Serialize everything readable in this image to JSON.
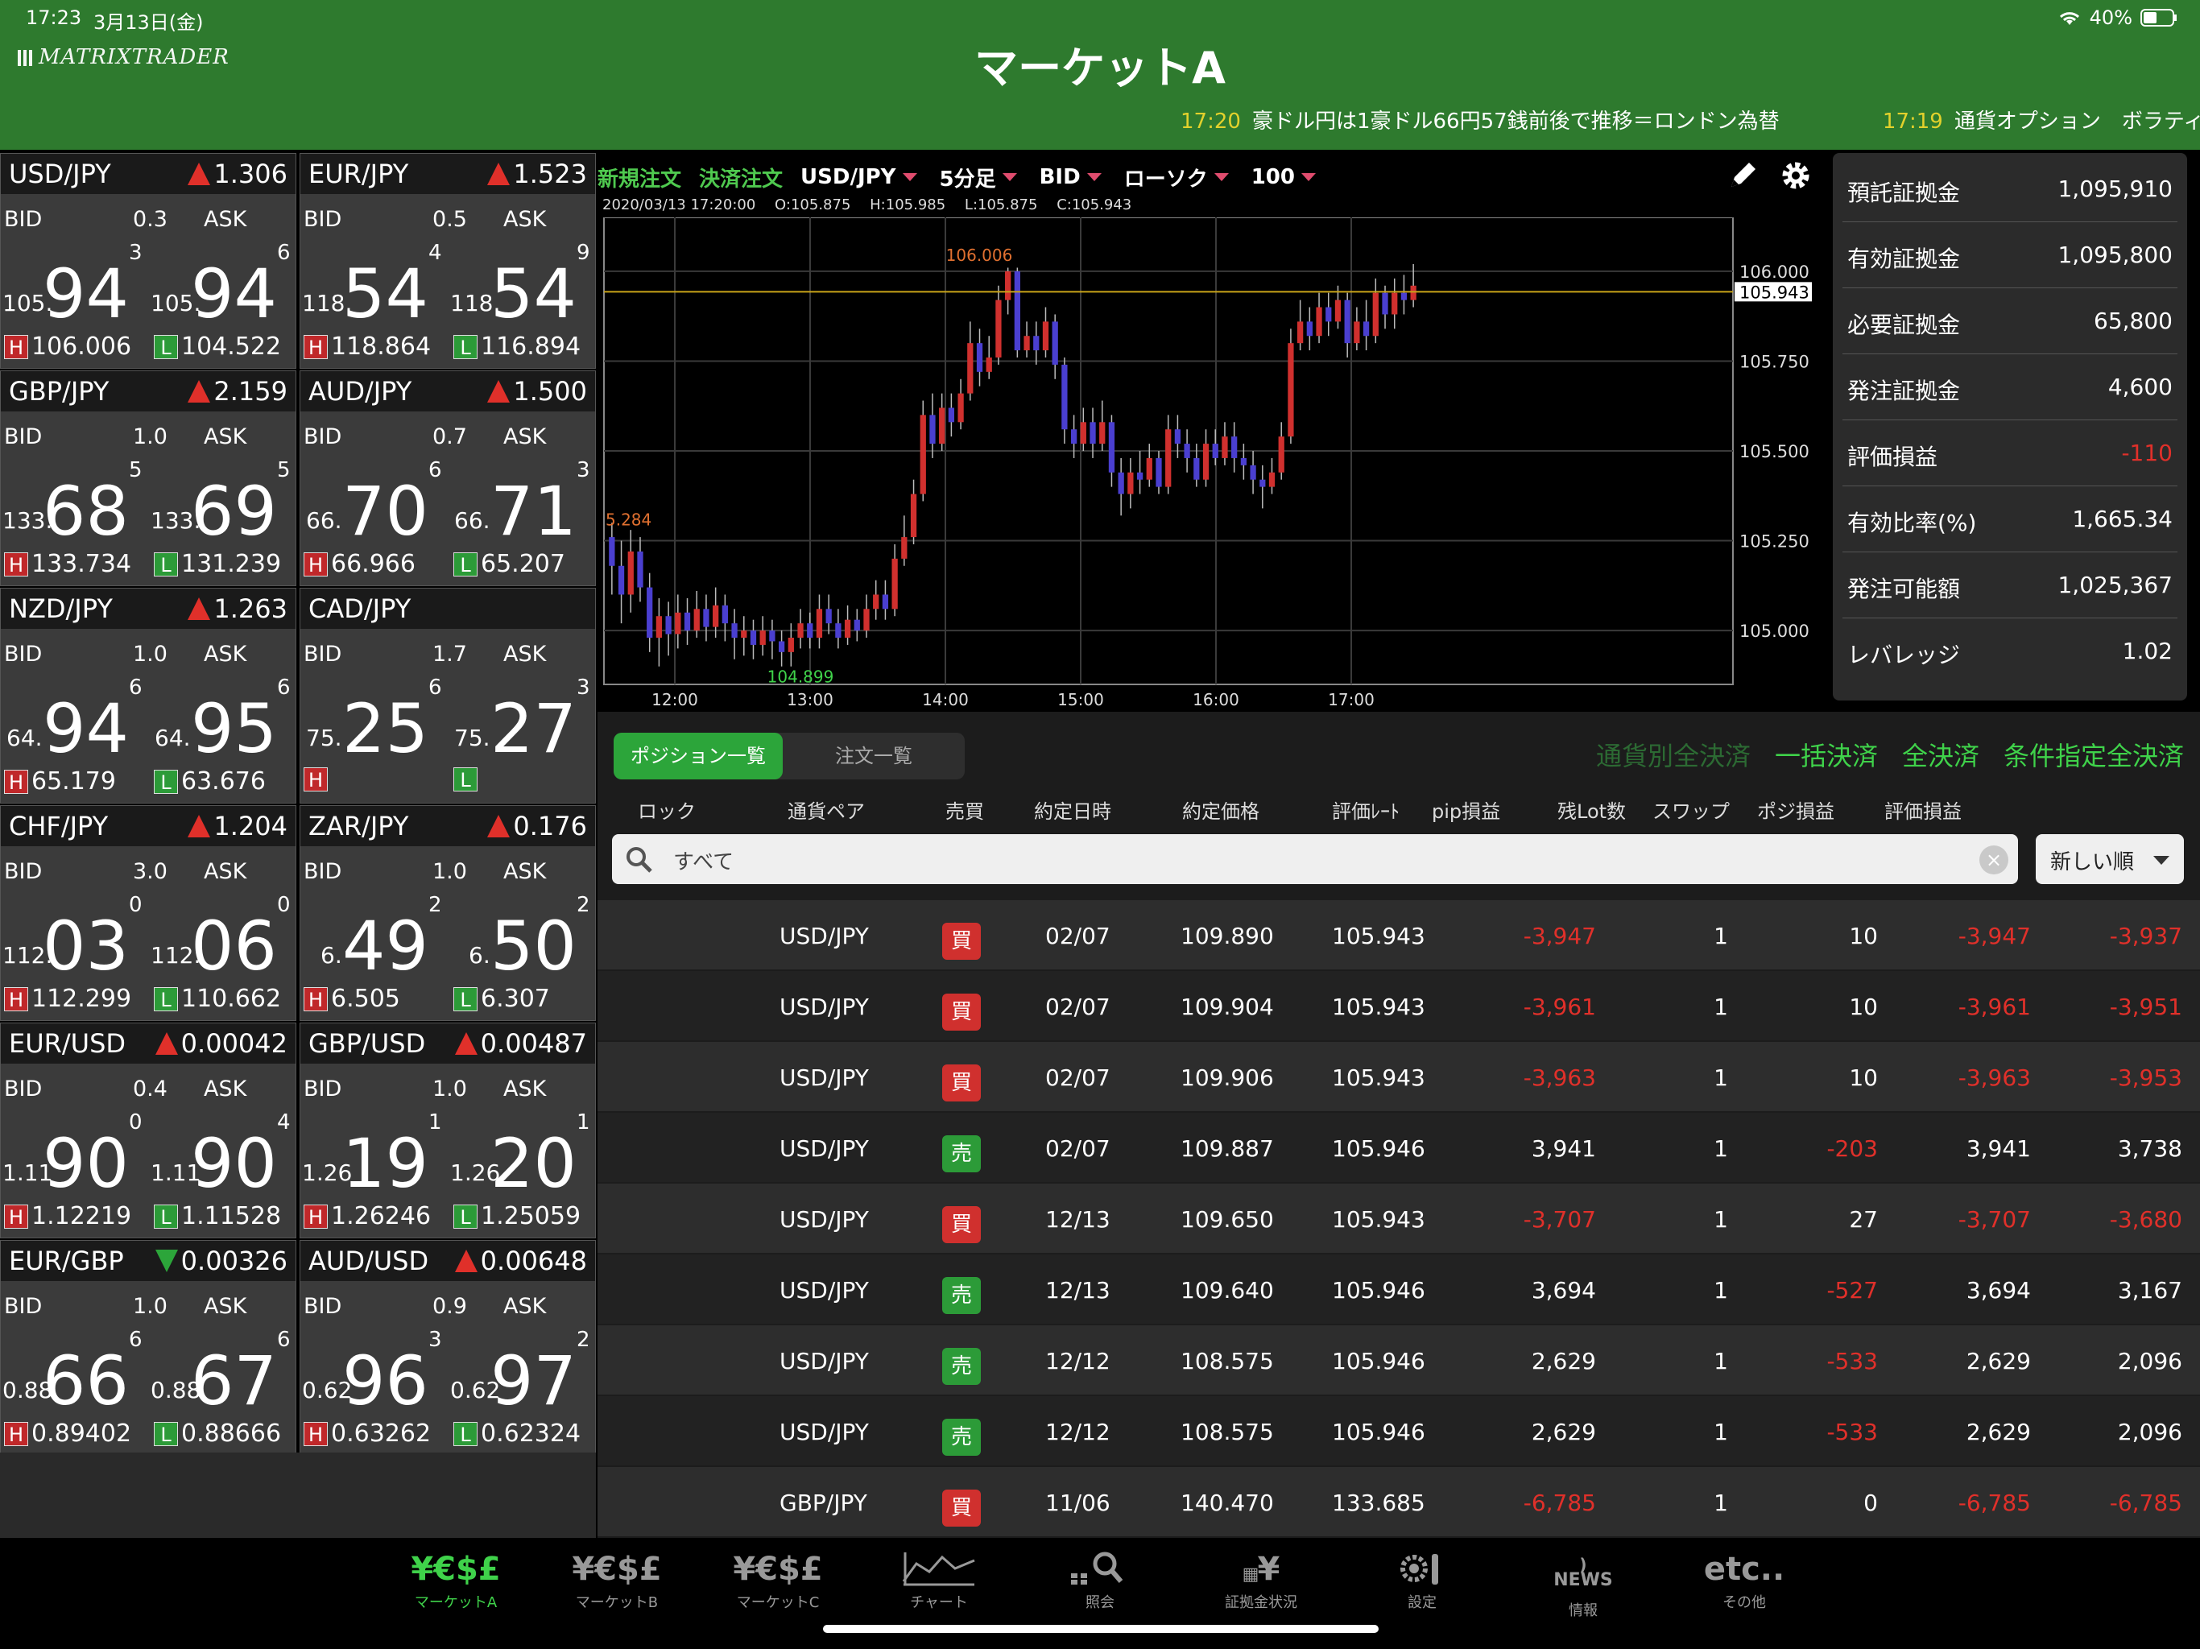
{
  "status": {
    "time": "17:23",
    "date": "3月13日(金)",
    "battery": "40%"
  },
  "header": {
    "logo": "MATRIXTRADER",
    "title": "マーケットA"
  },
  "ticker": [
    {
      "time": "17:20",
      "text": "豪ドル円は1豪ドル66円57銭前後で推移＝ロンドン為替"
    },
    {
      "time": "17:19",
      "text": "通貨オプション　ボラティリ"
    }
  ],
  "rate_labels": {
    "bid": "BID",
    "ask": "ASK",
    "h": "H",
    "l": "L"
  },
  "rates": [
    {
      "pair": "USD/JPY",
      "dir": "up",
      "change": "1.306",
      "spread": "0.3",
      "bid": {
        "pre": "105.",
        "big": "94",
        "sup": "3"
      },
      "ask": {
        "pre": "105.",
        "big": "94",
        "sup": "6"
      },
      "high": "106.006",
      "low": "104.522"
    },
    {
      "pair": "EUR/JPY",
      "dir": "up",
      "change": "1.523",
      "spread": "0.5",
      "bid": {
        "pre": "118.",
        "big": "54",
        "sup": "4"
      },
      "ask": {
        "pre": "118.",
        "big": "54",
        "sup": "9"
      },
      "high": "118.864",
      "low": "116.894"
    },
    {
      "pair": "GBP/JPY",
      "dir": "up",
      "change": "2.159",
      "spread": "1.0",
      "bid": {
        "pre": "133.",
        "big": "68",
        "sup": "5"
      },
      "ask": {
        "pre": "133.",
        "big": "69",
        "sup": "5"
      },
      "high": "133.734",
      "low": "131.239"
    },
    {
      "pair": "AUD/JPY",
      "dir": "up",
      "change": "1.500",
      "spread": "0.7",
      "bid": {
        "pre": "66.",
        "big": "70",
        "sup": "6"
      },
      "ask": {
        "pre": "66.",
        "big": "71",
        "sup": "3"
      },
      "high": "66.966",
      "low": "65.207"
    },
    {
      "pair": "NZD/JPY",
      "dir": "up",
      "change": "1.263",
      "spread": "1.0",
      "bid": {
        "pre": "64.",
        "big": "94",
        "sup": "6"
      },
      "ask": {
        "pre": "64.",
        "big": "95",
        "sup": "6"
      },
      "high": "65.179",
      "low": "63.676"
    },
    {
      "pair": "CAD/JPY",
      "dir": "none",
      "change": "",
      "spread": "1.7",
      "bid": {
        "pre": "75.",
        "big": "25",
        "sup": "6"
      },
      "ask": {
        "pre": "75.",
        "big": "27",
        "sup": "3"
      },
      "high": "",
      "low": ""
    },
    {
      "pair": "CHF/JPY",
      "dir": "up",
      "change": "1.204",
      "spread": "3.0",
      "bid": {
        "pre": "112.",
        "big": "03",
        "sup": "0"
      },
      "ask": {
        "pre": "112.",
        "big": "06",
        "sup": "0"
      },
      "high": "112.299",
      "low": "110.662"
    },
    {
      "pair": "ZAR/JPY",
      "dir": "up",
      "change": "0.176",
      "spread": "1.0",
      "bid": {
        "pre": "6.",
        "big": "49",
        "sup": "2"
      },
      "ask": {
        "pre": "6.",
        "big": "50",
        "sup": "2"
      },
      "high": "6.505",
      "low": "6.307"
    },
    {
      "pair": "EUR/USD",
      "dir": "up",
      "change": "0.00042",
      "spread": "0.4",
      "bid": {
        "pre": "1.11",
        "big": "90",
        "sup": "0"
      },
      "ask": {
        "pre": "1.11",
        "big": "90",
        "sup": "4"
      },
      "high": "1.12219",
      "low": "1.11528"
    },
    {
      "pair": "GBP/USD",
      "dir": "up",
      "change": "0.00487",
      "spread": "1.0",
      "bid": {
        "pre": "1.26",
        "big": "19",
        "sup": "1"
      },
      "ask": {
        "pre": "1.26",
        "big": "20",
        "sup": "1"
      },
      "high": "1.26246",
      "low": "1.25059"
    },
    {
      "pair": "EUR/GBP",
      "dir": "down",
      "change": "0.00326",
      "spread": "1.0",
      "bid": {
        "pre": "0.88",
        "big": "66",
        "sup": "6"
      },
      "ask": {
        "pre": "0.88",
        "big": "67",
        "sup": "6"
      },
      "high": "0.89402",
      "low": "0.88666"
    },
    {
      "pair": "AUD/USD",
      "dir": "up",
      "change": "0.00648",
      "spread": "0.9",
      "bid": {
        "pre": "0.62",
        "big": "96",
        "sup": "3"
      },
      "ask": {
        "pre": "0.62",
        "big": "97",
        "sup": "2"
      },
      "high": "0.63262",
      "low": "0.62324"
    }
  ],
  "chart_toolbar": {
    "new_order": "新規注文",
    "settle_order": "決済注文",
    "pair": "USD/JPY",
    "interval": "5分足",
    "side": "BID",
    "style": "ローソク",
    "count": "100"
  },
  "chart_info": {
    "datetime": "2020/03/13 17:20:00",
    "open": "O:105.875",
    "high": "H:105.985",
    "low": "L:105.875",
    "close": "C:105.943"
  },
  "chart_data": {
    "type": "candlestick",
    "ylim": [
      104.85,
      106.15
    ],
    "y_ticks": [
      "106.000",
      "105.750",
      "105.500",
      "105.250",
      "105.000"
    ],
    "x_ticks": [
      "12:00",
      "13:00",
      "14:00",
      "15:00",
      "16:00",
      "17:00"
    ],
    "current_price": "105.943",
    "high_label": "106.006",
    "low_label": "104.899",
    "left_label": "5.284",
    "candles": [
      [
        105.26,
        105.18,
        105.3,
        105.1
      ],
      [
        105.18,
        105.1,
        105.25,
        105.02
      ],
      [
        105.1,
        105.22,
        105.28,
        105.05
      ],
      [
        105.22,
        105.12,
        105.26,
        105.08
      ],
      [
        105.12,
        104.98,
        105.16,
        104.94
      ],
      [
        104.98,
        105.04,
        105.09,
        104.9
      ],
      [
        105.04,
        104.99,
        105.08,
        104.93
      ],
      [
        104.99,
        105.05,
        105.1,
        104.95
      ],
      [
        105.05,
        105.0,
        105.09,
        104.96
      ],
      [
        105.0,
        105.06,
        105.11,
        104.98
      ],
      [
        105.06,
        105.01,
        105.1,
        104.97
      ],
      [
        105.01,
        105.07,
        105.12,
        104.98
      ],
      [
        105.07,
        105.02,
        105.1,
        104.97
      ],
      [
        105.02,
        104.98,
        105.06,
        104.92
      ],
      [
        104.98,
        105.0,
        105.04,
        104.93
      ],
      [
        105.0,
        104.96,
        105.03,
        104.92
      ],
      [
        104.96,
        105.0,
        105.04,
        104.93
      ],
      [
        105.0,
        104.97,
        105.03,
        104.92
      ],
      [
        104.97,
        104.94,
        105.0,
        104.9
      ],
      [
        104.94,
        104.98,
        105.02,
        104.9
      ],
      [
        104.98,
        105.02,
        105.06,
        104.95
      ],
      [
        105.02,
        104.98,
        105.05,
        104.95
      ],
      [
        104.98,
        105.06,
        105.1,
        104.95
      ],
      [
        105.06,
        105.02,
        105.1,
        104.99
      ],
      [
        105.02,
        104.98,
        105.06,
        104.95
      ],
      [
        104.98,
        105.03,
        105.07,
        104.96
      ],
      [
        105.03,
        105.0,
        105.06,
        104.97
      ],
      [
        105.0,
        105.06,
        105.1,
        104.98
      ],
      [
        105.06,
        105.1,
        105.14,
        105.03
      ],
      [
        105.1,
        105.06,
        105.14,
        105.03
      ],
      [
        105.06,
        105.2,
        105.24,
        105.04
      ],
      [
        105.2,
        105.26,
        105.32,
        105.18
      ],
      [
        105.26,
        105.38,
        105.42,
        105.24
      ],
      [
        105.38,
        105.6,
        105.64,
        105.36
      ],
      [
        105.6,
        105.52,
        105.66,
        105.48
      ],
      [
        105.52,
        105.62,
        105.66,
        105.5
      ],
      [
        105.62,
        105.58,
        105.66,
        105.54
      ],
      [
        105.58,
        105.66,
        105.7,
        105.56
      ],
      [
        105.66,
        105.8,
        105.86,
        105.64
      ],
      [
        105.8,
        105.72,
        105.84,
        105.68
      ],
      [
        105.72,
        105.76,
        105.82,
        105.7
      ],
      [
        105.76,
        105.92,
        105.96,
        105.74
      ],
      [
        105.92,
        106.0,
        106.01,
        105.88
      ],
      [
        106.0,
        105.78,
        106.01,
        105.76
      ],
      [
        105.78,
        105.82,
        105.86,
        105.76
      ],
      [
        105.82,
        105.78,
        105.86,
        105.74
      ],
      [
        105.78,
        105.86,
        105.9,
        105.76
      ],
      [
        105.86,
        105.74,
        105.88,
        105.7
      ],
      [
        105.74,
        105.56,
        105.76,
        105.52
      ],
      [
        105.56,
        105.52,
        105.6,
        105.48
      ],
      [
        105.52,
        105.58,
        105.62,
        105.5
      ],
      [
        105.58,
        105.52,
        105.62,
        105.48
      ],
      [
        105.52,
        105.58,
        105.64,
        105.5
      ],
      [
        105.58,
        105.44,
        105.6,
        105.4
      ],
      [
        105.44,
        105.38,
        105.48,
        105.32
      ],
      [
        105.38,
        105.44,
        105.48,
        105.34
      ],
      [
        105.44,
        105.42,
        105.5,
        105.38
      ],
      [
        105.42,
        105.48,
        105.52,
        105.4
      ],
      [
        105.48,
        105.4,
        105.5,
        105.38
      ],
      [
        105.4,
        105.56,
        105.6,
        105.38
      ],
      [
        105.56,
        105.52,
        105.6,
        105.48
      ],
      [
        105.52,
        105.48,
        105.56,
        105.44
      ],
      [
        105.48,
        105.42,
        105.52,
        105.4
      ],
      [
        105.42,
        105.52,
        105.56,
        105.4
      ],
      [
        105.52,
        105.48,
        105.56,
        105.46
      ],
      [
        105.48,
        105.54,
        105.58,
        105.46
      ],
      [
        105.54,
        105.48,
        105.58,
        105.44
      ],
      [
        105.48,
        105.46,
        105.52,
        105.42
      ],
      [
        105.46,
        105.42,
        105.5,
        105.38
      ],
      [
        105.42,
        105.4,
        105.46,
        105.34
      ],
      [
        105.4,
        105.44,
        105.48,
        105.38
      ],
      [
        105.44,
        105.54,
        105.58,
        105.42
      ],
      [
        105.54,
        105.8,
        105.84,
        105.52
      ],
      [
        105.8,
        105.86,
        105.92,
        105.78
      ],
      [
        105.86,
        105.82,
        105.9,
        105.78
      ],
      [
        105.82,
        105.9,
        105.94,
        105.8
      ],
      [
        105.9,
        105.86,
        105.94,
        105.82
      ],
      [
        105.86,
        105.92,
        105.96,
        105.84
      ],
      [
        105.92,
        105.8,
        105.94,
        105.76
      ],
      [
        105.8,
        105.86,
        105.9,
        105.78
      ],
      [
        105.86,
        105.82,
        105.92,
        105.78
      ],
      [
        105.82,
        105.94,
        105.98,
        105.8
      ],
      [
        105.94,
        105.88,
        105.96,
        105.84
      ],
      [
        105.88,
        105.94,
        105.98,
        105.84
      ],
      [
        105.94,
        105.92,
        105.99,
        105.88
      ],
      [
        105.92,
        105.96,
        106.02,
        105.9
      ]
    ]
  },
  "account": [
    {
      "label": "預託証拠金",
      "value": "1,095,910"
    },
    {
      "label": "有効証拠金",
      "value": "1,095,800"
    },
    {
      "label": "必要証拠金",
      "value": "65,800"
    },
    {
      "label": "発注証拠金",
      "value": "4,600"
    },
    {
      "label": "評価損益",
      "value": "-110"
    },
    {
      "label": "有効比率(%)",
      "value": "1,665.34"
    },
    {
      "label": "発注可能額",
      "value": "1,025,367"
    },
    {
      "label": "レバレッジ",
      "value": "1.02"
    }
  ],
  "positions": {
    "tabs": [
      "ポジション一覧",
      "注文一覧"
    ],
    "actions": [
      "通貨別全決済",
      "一括決済",
      "全決済",
      "条件指定全決済"
    ],
    "columns": [
      "ロック",
      "通貨ペア",
      "売買",
      "約定日時",
      "約定価格",
      "評価ﾚｰﾄ",
      "pip損益",
      "残Lot数",
      "スワップ",
      "ポジ損益",
      "評価損益"
    ],
    "filter": "すべて",
    "sort": "新しい順",
    "rows": [
      {
        "pair": "USD/JPY",
        "side": "買",
        "date": "02/07",
        "price": "109.890",
        "rate": "105.943",
        "pip": "-3,947",
        "lot": "1",
        "swap": "10",
        "pos": "-3,947",
        "eval": "-3,937"
      },
      {
        "pair": "USD/JPY",
        "side": "買",
        "date": "02/07",
        "price": "109.904",
        "rate": "105.943",
        "pip": "-3,961",
        "lot": "1",
        "swap": "10",
        "pos": "-3,961",
        "eval": "-3,951"
      },
      {
        "pair": "USD/JPY",
        "side": "買",
        "date": "02/07",
        "price": "109.906",
        "rate": "105.943",
        "pip": "-3,963",
        "lot": "1",
        "swap": "10",
        "pos": "-3,963",
        "eval": "-3,953"
      },
      {
        "pair": "USD/JPY",
        "side": "売",
        "date": "02/07",
        "price": "109.887",
        "rate": "105.946",
        "pip": "3,941",
        "lot": "1",
        "swap": "-203",
        "pos": "3,941",
        "eval": "3,738"
      },
      {
        "pair": "USD/JPY",
        "side": "買",
        "date": "12/13",
        "price": "109.650",
        "rate": "105.943",
        "pip": "-3,707",
        "lot": "1",
        "swap": "27",
        "pos": "-3,707",
        "eval": "-3,680"
      },
      {
        "pair": "USD/JPY",
        "side": "売",
        "date": "12/13",
        "price": "109.640",
        "rate": "105.946",
        "pip": "3,694",
        "lot": "1",
        "swap": "-527",
        "pos": "3,694",
        "eval": "3,167"
      },
      {
        "pair": "USD/JPY",
        "side": "売",
        "date": "12/12",
        "price": "108.575",
        "rate": "105.946",
        "pip": "2,629",
        "lot": "1",
        "swap": "-533",
        "pos": "2,629",
        "eval": "2,096"
      },
      {
        "pair": "USD/JPY",
        "side": "売",
        "date": "12/12",
        "price": "108.575",
        "rate": "105.946",
        "pip": "2,629",
        "lot": "1",
        "swap": "-533",
        "pos": "2,629",
        "eval": "2,096"
      },
      {
        "pair": "GBP/JPY",
        "side": "買",
        "date": "11/06",
        "price": "140.470",
        "rate": "133.685",
        "pip": "-6,785",
        "lot": "1",
        "swap": "0",
        "pos": "-6,785",
        "eval": "-6,785"
      }
    ]
  },
  "tabbar": [
    {
      "icon": "¥€$£",
      "label": "マーケットA",
      "active": true
    },
    {
      "icon": "¥€$£",
      "label": "マーケットB",
      "active": false
    },
    {
      "icon": "chart-icon",
      "label": "チャート",
      "active": false
    },
    {
      "icon": "search-icon",
      "label": "照会",
      "active": false
    },
    {
      "icon": "¥",
      "label": "証拠金状況",
      "active": false
    },
    {
      "icon": "settings-icon",
      "label": "設定",
      "active": false
    },
    {
      "icon": "NEWS",
      "label": "情報",
      "active": false
    },
    {
      "icon": "etc..",
      "label": "その他",
      "active": false
    }
  ],
  "tabbar_extra": {
    "icon": "¥€$£",
    "label": "マーケットC"
  },
  "colors": {
    "header": "#2e7a2e",
    "accent": "#3fd24a",
    "negative": "#e0302a",
    "candle_up": "#d0302e",
    "candle_down": "#4a3fd0"
  }
}
